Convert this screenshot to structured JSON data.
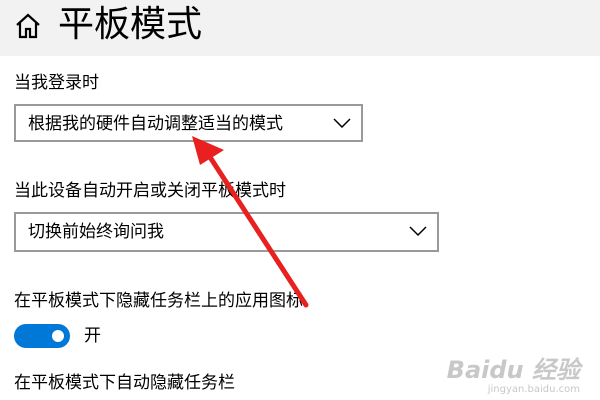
{
  "page": {
    "title": "平板模式",
    "home_icon": "home-icon"
  },
  "sign_in": {
    "label": "当我登录时",
    "selected": "根据我的硬件自动调整适当的模式",
    "icon": "chevron-down-icon"
  },
  "auto_switch": {
    "label": "当此设备自动开启或关闭平板模式时",
    "selected": "切换前始终询问我",
    "icon": "chevron-down-icon"
  },
  "hide_app_icons": {
    "label": "在平板模式下隐藏任务栏上的应用图标",
    "state_label": "开",
    "on": true,
    "accent": "#0078d7"
  },
  "auto_hide_taskbar": {
    "label": "在平板模式下自动隐藏任务栏"
  },
  "annotation": {
    "type": "red-arrow",
    "color": "#e82020"
  },
  "watermark": {
    "logo": "Baidu 经验",
    "url": "jingyan.baidu.com"
  }
}
